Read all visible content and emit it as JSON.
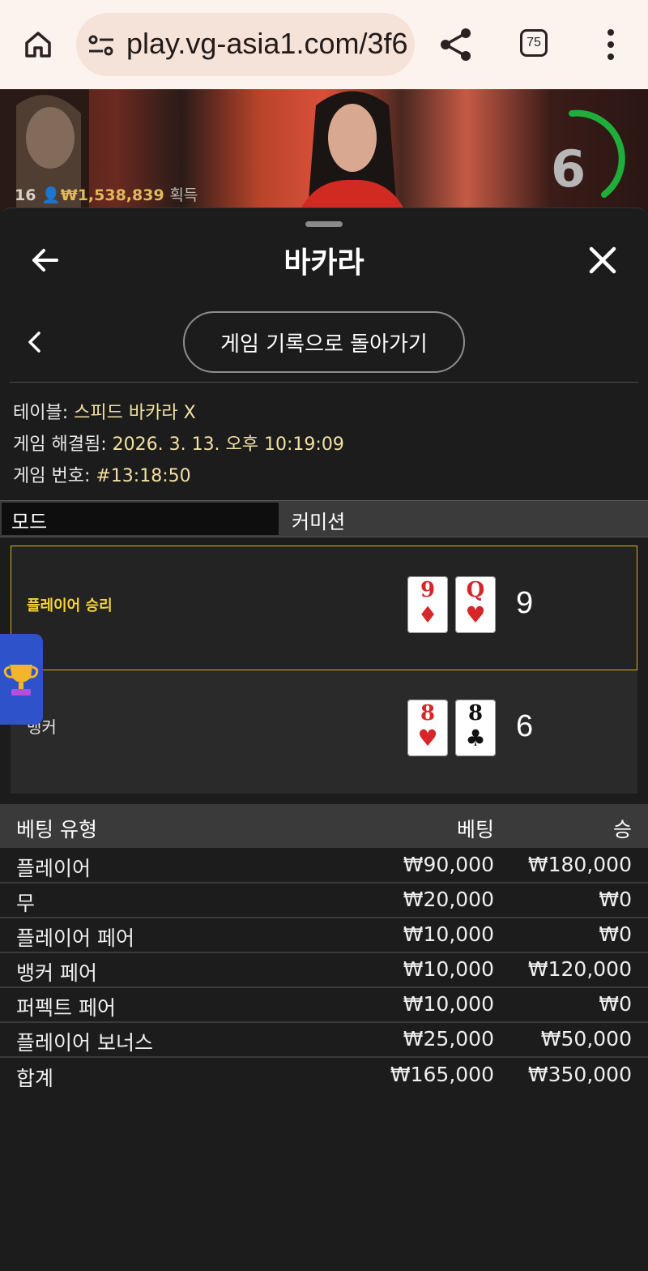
{
  "browser": {
    "url": "play.vg-asia1.com/3f6",
    "tab_count": "75"
  },
  "video": {
    "player_count": "16",
    "winnings": "₩1,538,839",
    "winnings_suffix": "획득",
    "timer": "6"
  },
  "panel": {
    "title": "바카라",
    "history_button": "게임 기록으로 돌아가기"
  },
  "info": {
    "table_label": "테이블: ",
    "table_value": "스피드 바카라 X",
    "resolved_label": "게임 해결됨: ",
    "resolved_value": "2026. 3. 13. 오후 10:19:09",
    "game_no_label": "게임 번호: ",
    "game_no_value": "#13:18:50"
  },
  "mode": {
    "label": "모드",
    "value": "커미션"
  },
  "result": {
    "player": {
      "label": "플레이어 승리",
      "cards": [
        {
          "rank": "9",
          "suit": "♦",
          "color": "#d6262a"
        },
        {
          "rank": "Q",
          "suit": "♥",
          "color": "#d6262a"
        }
      ],
      "score": "9"
    },
    "banker": {
      "label": "뱅커",
      "cards": [
        {
          "rank": "8",
          "suit": "♥",
          "color": "#d6262a"
        },
        {
          "rank": "8",
          "suit": "♣",
          "color": "#111111"
        }
      ],
      "score": "6"
    }
  },
  "bets": {
    "headers": {
      "type": "베팅 유형",
      "bet": "베팅",
      "win": "승"
    },
    "rows": [
      {
        "type": "플레이어",
        "bet": "₩90,000",
        "win": "₩180,000"
      },
      {
        "type": "무",
        "bet": "₩20,000",
        "win": "₩0"
      },
      {
        "type": "플레이어 페어",
        "bet": "₩10,000",
        "win": "₩0"
      },
      {
        "type": "뱅커 페어",
        "bet": "₩10,000",
        "win": "₩120,000"
      },
      {
        "type": "퍼펙트 페어",
        "bet": "₩10,000",
        "win": "₩0"
      },
      {
        "type": "플레이어 보너스",
        "bet": "₩25,000",
        "win": "₩50,000"
      }
    ],
    "total": {
      "type": "합계",
      "bet": "₩165,000",
      "win": "₩350,000"
    }
  }
}
